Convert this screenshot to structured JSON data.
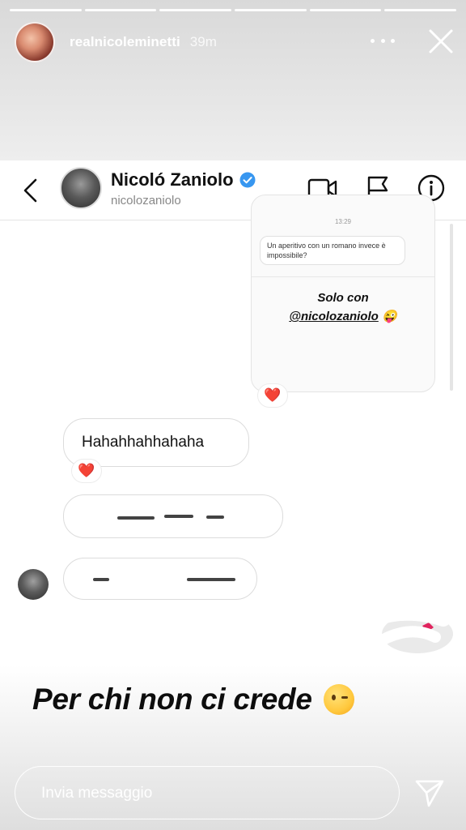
{
  "story": {
    "progress_segments": 6,
    "username": "realnicoleminetti",
    "time": "39m"
  },
  "dm": {
    "name": "Nicoló Zaniolo",
    "handle": "nicolozaniolo"
  },
  "shared_story": {
    "time": "13:29",
    "question": "Un aperitivo con un romano invece è impossibile?",
    "answer_line1": "Solo con",
    "answer_mention": "@nicolozaniolo",
    "answer_emoji": "😜"
  },
  "messages": [
    {
      "text": "Hahahhahhahaha",
      "reaction": "❤️"
    }
  ],
  "reactions": {
    "shared_story": "❤️"
  },
  "caption": "Per chi non ci crede",
  "message_bar": {
    "placeholder": "Invia messaggio"
  },
  "colors": {
    "verified": "#3897f0",
    "heart": "#e0245e"
  },
  "icons": [
    "more-icon",
    "close-icon",
    "back-icon",
    "verified-icon",
    "video-call-icon",
    "flag-icon",
    "info-icon",
    "send-icon"
  ]
}
